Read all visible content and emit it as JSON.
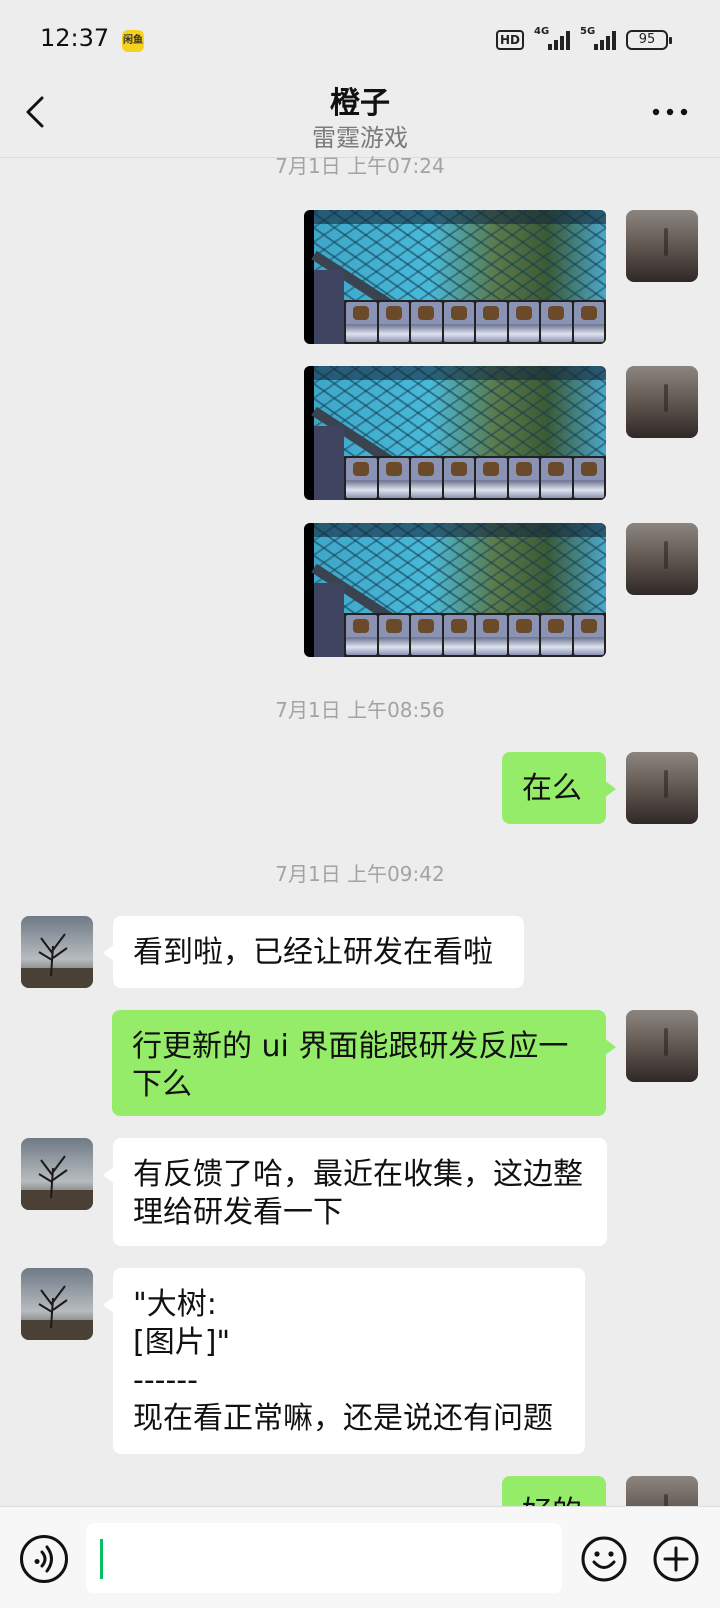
{
  "status_bar": {
    "time": "12:37",
    "app_badge": "闲鱼",
    "hd": "HD",
    "net1": "4G",
    "net2": "5G",
    "battery": "95"
  },
  "header": {
    "title": "橙子",
    "subtitle": "雷霆游戏",
    "back_icon": "chevron-left-icon",
    "more_icon": "more-horizontal-icon"
  },
  "messages": {
    "ts1": "7月1日 上午07:24",
    "ts2": "7月1日 上午08:56",
    "ts3": "7月1日 上午09:42",
    "m_zaime": "在么",
    "m_other1": "看到啦，已经让研发在看啦",
    "m_me2": "行更新的 ui 界面能跟研发反应一下么",
    "m_other2": "有反馈了哈，最近在收集，这边整理给研发看一下",
    "m_other3": "\"大树:\n[图片]\"\n------\n现在看正常嘛，还是说还有问题",
    "m_me_partial": "好的"
  },
  "input_bar": {
    "placeholder": "",
    "voice_icon": "voice-icon",
    "emoji_icon": "emoji-icon",
    "plus_icon": "plus-circle-icon"
  },
  "colors": {
    "background": "#ededed",
    "bubble_me": "#95ec69",
    "bubble_other": "#ffffff",
    "accent": "#07c160"
  }
}
